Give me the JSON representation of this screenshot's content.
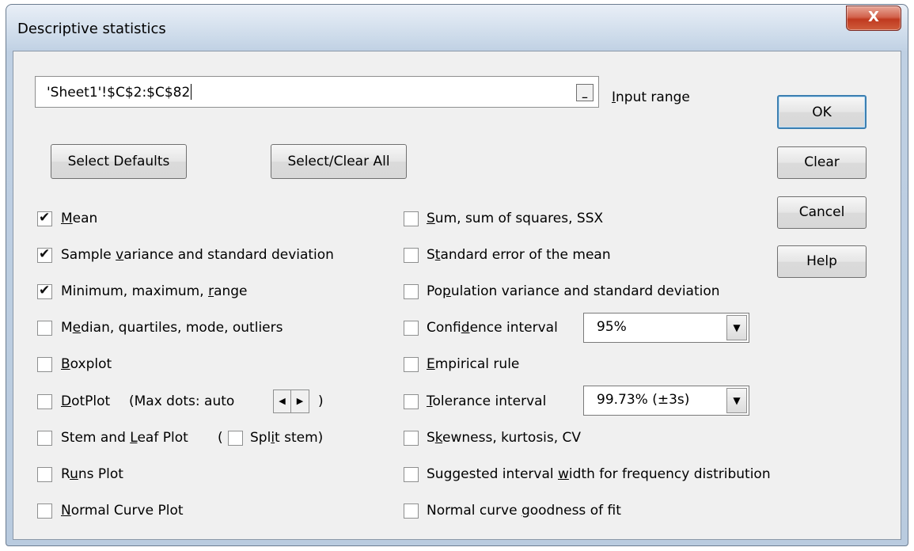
{
  "window": {
    "title": "Descriptive statistics",
    "close_label": "X"
  },
  "input": {
    "value": "'Sheet1'!$C$2:$C$82",
    "collapse_label": "_",
    "label_pre": "",
    "label_u": "I",
    "label_post": "nput range"
  },
  "buttons": {
    "select_defaults": "Select Defaults",
    "select_clear_all": "Select/Clear All",
    "ok": "OK",
    "clear": "Clear",
    "cancel": "Cancel",
    "help": "Help"
  },
  "left_options": [
    {
      "pre": "",
      "u": "M",
      "post": "ean",
      "checked": true
    },
    {
      "pre": "Sample ",
      "u": "v",
      "post": "ariance and standard deviation",
      "checked": true
    },
    {
      "pre": "Minimum, maximum, ",
      "u": "r",
      "post": "ange",
      "checked": true
    },
    {
      "pre": "M",
      "u": "e",
      "post": "dian, quartiles, mode, outliers",
      "checked": false
    },
    {
      "pre": "",
      "u": "B",
      "post": "oxplot",
      "checked": false
    },
    {
      "pre": "",
      "u": "D",
      "post": "otPlot",
      "checked": false
    },
    {
      "pre": "Stem and ",
      "u": "L",
      "post": "eaf Plot",
      "checked": false
    },
    {
      "pre": "R",
      "u": "u",
      "post": "ns Plot",
      "checked": false
    },
    {
      "pre": "",
      "u": "N",
      "post": "ormal Curve Plot",
      "checked": false
    }
  ],
  "dotplot_extra": {
    "label": "(Max dots: auto",
    "close_paren": ")",
    "spin_left": "◀",
    "spin_right": "▶"
  },
  "stem_extra": {
    "open_paren": "(",
    "pre": "Spl",
    "u": "i",
    "post": "t stem)",
    "checked": false
  },
  "right_options": [
    {
      "pre": "",
      "u": "S",
      "post": "um, sum of squares, SSX",
      "checked": false
    },
    {
      "pre": "S",
      "u": "t",
      "post": "andard error of the mean",
      "checked": false
    },
    {
      "pre": "Po",
      "u": "p",
      "post": "ulation variance and standard deviation",
      "checked": false
    },
    {
      "pre": "Confi",
      "u": "d",
      "post": "ence interval",
      "checked": false
    },
    {
      "pre": "",
      "u": "E",
      "post": "mpirical rule",
      "checked": false
    },
    {
      "pre": "",
      "u": "T",
      "post": "olerance interval",
      "checked": false
    },
    {
      "pre": "S",
      "u": "k",
      "post": "ewness, kurtosis, CV",
      "checked": false
    },
    {
      "pre": "Suggested interval ",
      "u": "w",
      "post": "idth for frequency distribution",
      "checked": false
    },
    {
      "pre": "Normal curve ",
      "u": "g",
      "post": "oodness of fit",
      "checked": false
    }
  ],
  "confidence_select": {
    "value": "95%",
    "arrow": "▼"
  },
  "tolerance_select": {
    "value": "99.73% (±3s)",
    "arrow": "▼"
  }
}
